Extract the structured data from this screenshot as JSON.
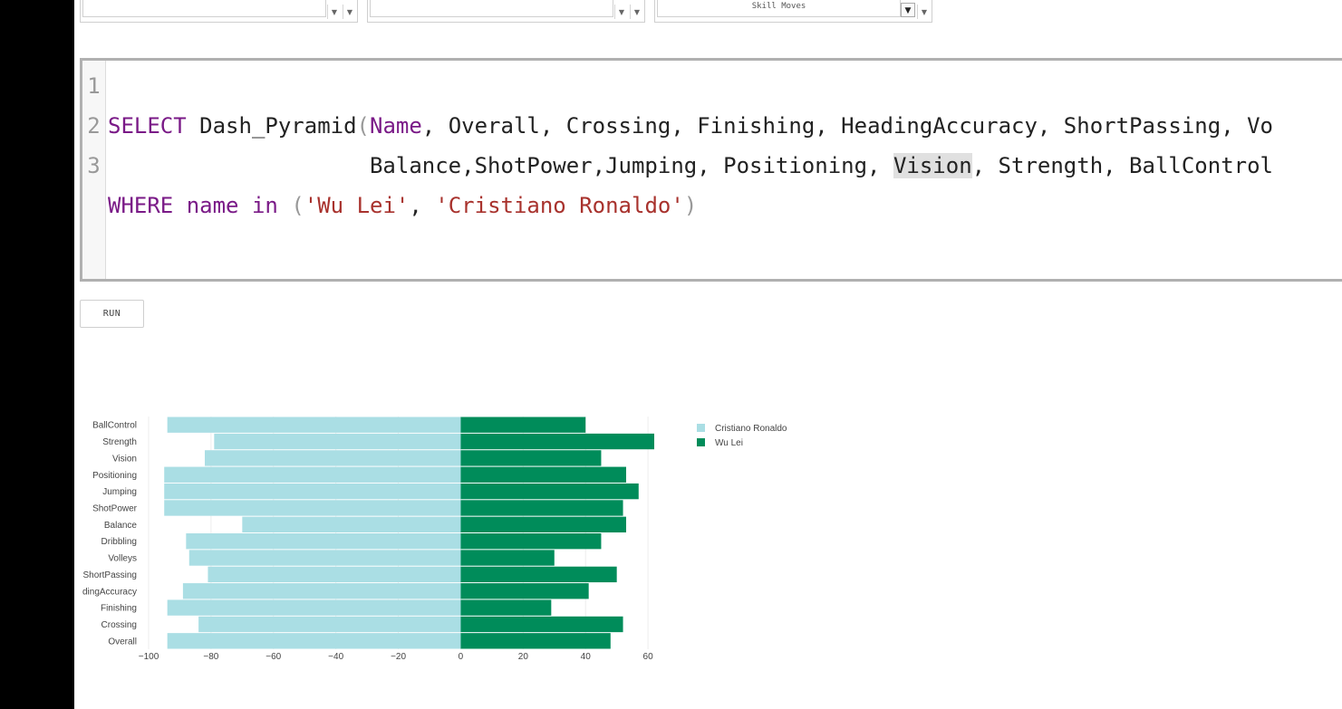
{
  "filters": {
    "dropdown1_value": "",
    "dropdown2_value": "",
    "dropdown3_value": "Skill Moves"
  },
  "editor": {
    "lines": [
      {
        "num": "1"
      },
      {
        "num": "2"
      },
      {
        "num": "3"
      }
    ],
    "line1": {
      "kw_select": "SELECT",
      "fn_name": " Dash_Pyramid",
      "open_paren": "(",
      "first_arg": "Name",
      "rest": ", Overall, Crossing, Finishing, HeadingAccuracy, ShortPassing, Vo"
    },
    "line2": {
      "before": "                    Balance,ShotPower,Jumping, Positioning, ",
      "highlight": "Vision",
      "after": ", Strength, BallControl"
    },
    "line3": {
      "kw_where": "WHERE",
      "kw_name": " name",
      "kw_in": " in",
      "space": " ",
      "open_paren": "(",
      "str1": "'Wu Lei'",
      "comma": ", ",
      "str2": "'Cristiano Ronaldo'",
      "close_paren": ")"
    }
  },
  "run_button": {
    "label": "RUN"
  },
  "chart_data": {
    "type": "bar",
    "orientation": "horizontal-pyramid",
    "categories": [
      "Overall",
      "Crossing",
      "Finishing",
      "dingAccuracy",
      "ShortPassing",
      "Volleys",
      "Dribbling",
      "Balance",
      "ShotPower",
      "Jumping",
      "Positioning",
      "Vision",
      "Strength",
      "BallControl"
    ],
    "series": [
      {
        "name": "Cristiano Ronaldo",
        "color": "#aadee4",
        "values": [
          -94,
          -84,
          -94,
          -89,
          -81,
          -87,
          -88,
          -70,
          -95,
          -95,
          -95,
          -82,
          -79,
          -94
        ]
      },
      {
        "name": "Wu Lei",
        "color": "#008c5a",
        "values": [
          48,
          52,
          29,
          41,
          50,
          30,
          45,
          53,
          52,
          57,
          53,
          45,
          62,
          40
        ]
      }
    ],
    "xlim": [
      -100,
      62
    ],
    "xticks": [
      -100,
      -80,
      -60,
      -40,
      -20,
      0,
      20,
      40,
      60
    ],
    "xtick_labels": [
      "−100",
      "−80",
      "−60",
      "−40",
      "−20",
      "0",
      "20",
      "40",
      "60"
    ],
    "grid": true,
    "legend": "right"
  }
}
